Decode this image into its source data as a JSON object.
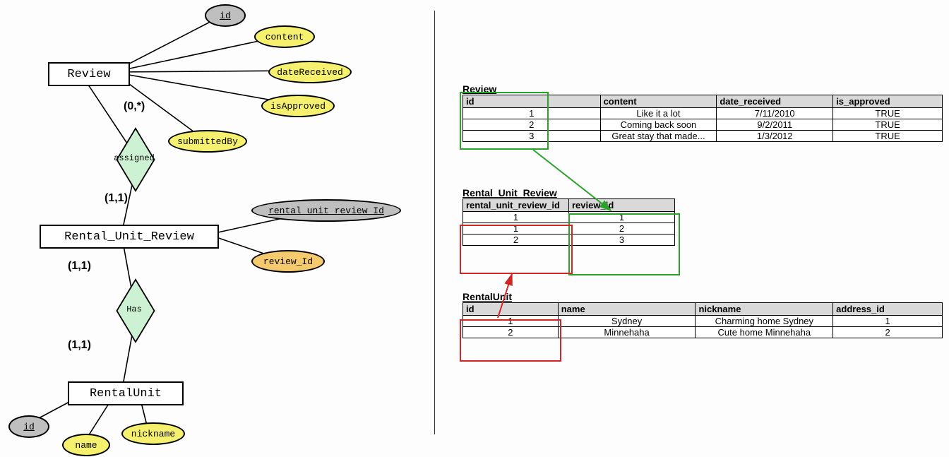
{
  "er": {
    "entities": {
      "review": "Review",
      "rur": "Rental_Unit_Review",
      "rentalunit": "RentalUnit"
    },
    "attrs": {
      "review_id": "id",
      "content": "content",
      "dateReceived": "dateReceived",
      "isApproved": "isApproved",
      "submittedBy": "submittedBy",
      "rur_id": "rental_unit_review_Id",
      "review_fk": "review_Id",
      "ru_id": "id",
      "ru_name": "name",
      "ru_nickname": "nickname"
    },
    "rels": {
      "assigned": "assigned",
      "has": "Has"
    },
    "cards": {
      "c1": "(0,*)",
      "c2": "(1,1)",
      "c3": "(1,1)",
      "c4": "(1,1)"
    }
  },
  "tables": {
    "review": {
      "title": "Review",
      "headers": [
        "id",
        "content",
        "date_received",
        "is_approved"
      ],
      "rows": [
        [
          "1",
          "Like it a lot",
          "7/11/2010",
          "TRUE"
        ],
        [
          "2",
          "Coming back soon",
          "9/2/2011",
          "TRUE"
        ],
        [
          "3",
          "Great stay that made...",
          "1/3/2012",
          "TRUE"
        ]
      ]
    },
    "rur": {
      "title": "Rental_Unit_Review",
      "headers": [
        "rental_unit_review_id",
        "review_id"
      ],
      "rows": [
        [
          "1",
          "1"
        ],
        [
          "1",
          "2"
        ],
        [
          "2",
          "3"
        ]
      ]
    },
    "rentalunit": {
      "title": "RentalUnit",
      "headers": [
        "id",
        "name",
        "nickname",
        "address_id"
      ],
      "rows": [
        [
          "1",
          "Sydney",
          "Charming home Sydney",
          "1"
        ],
        [
          "2",
          "Minnehaha",
          "Cute home Minnehaha",
          "2"
        ]
      ]
    }
  }
}
